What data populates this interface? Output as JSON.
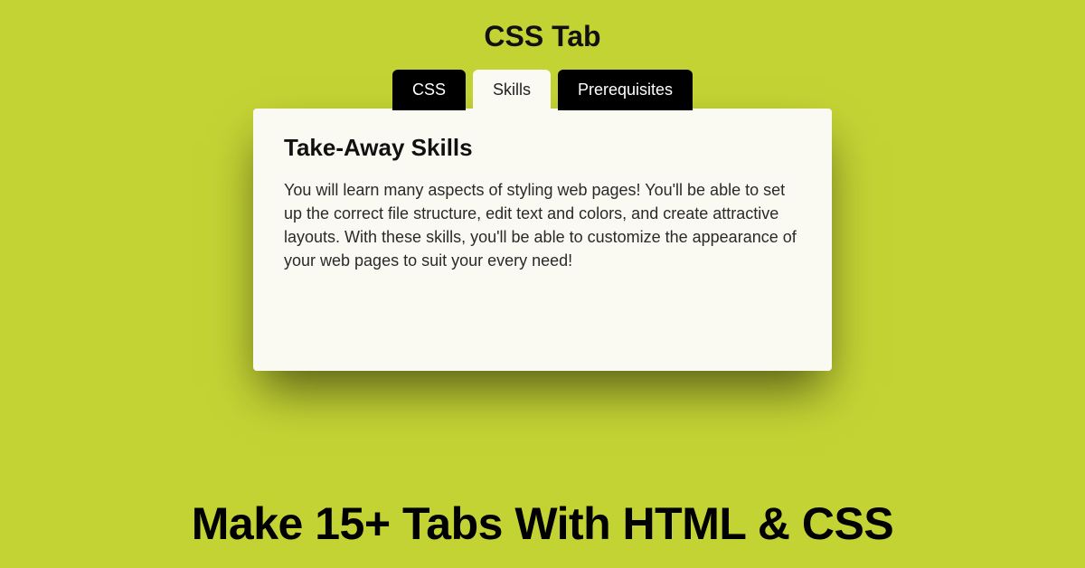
{
  "header": {
    "title": "CSS Tab"
  },
  "tabs": [
    {
      "label": "CSS",
      "active": false
    },
    {
      "label": "Skills",
      "active": true
    },
    {
      "label": "Prerequisites",
      "active": false
    }
  ],
  "panel": {
    "heading": "Take-Away Skills",
    "body": "You will learn many aspects of styling web pages! You'll be able to set up the correct file structure, edit text and colors, and create attractive layouts. With these skills, you'll be able to customize the appearance of your web pages to suit your every need!"
  },
  "banner": {
    "text": "Make 15+ Tabs With HTML & CSS"
  }
}
